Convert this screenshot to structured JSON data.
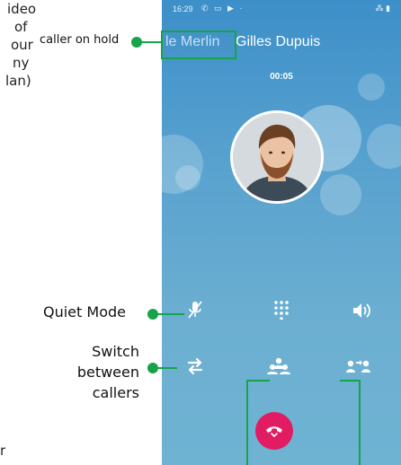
{
  "callouts": {
    "caller_on_hold": "caller on hold",
    "quiet_mode": "Quiet Mode",
    "switch_callers": [
      "Switch",
      "between",
      "callers"
    ]
  },
  "partial_left_text": [
    "ideo",
    "of",
    "our",
    "ny",
    "lan)"
  ],
  "partial_bottom_text": "r",
  "status_bar": {
    "time": "16:29"
  },
  "call": {
    "held_caller": "le Merlin",
    "active_caller": "Gilles Dupuis",
    "timer": "00:05"
  },
  "controls": [
    {
      "name": "mute",
      "icon": "microphone-off-icon"
    },
    {
      "name": "dialpad",
      "icon": "dialpad-icon"
    },
    {
      "name": "speaker",
      "icon": "speaker-icon"
    },
    {
      "name": "switch-callers",
      "icon": "swap-arrows-icon"
    },
    {
      "name": "merge-calls",
      "icon": "conference-icon"
    },
    {
      "name": "transfer",
      "icon": "transfer-call-icon"
    },
    {
      "name": "end-call",
      "icon": "hang-up-icon"
    }
  ],
  "colors": {
    "callout_green": "#16a34a",
    "end_call_red": "#e21c62",
    "background_blue": "#5aa3cf"
  }
}
